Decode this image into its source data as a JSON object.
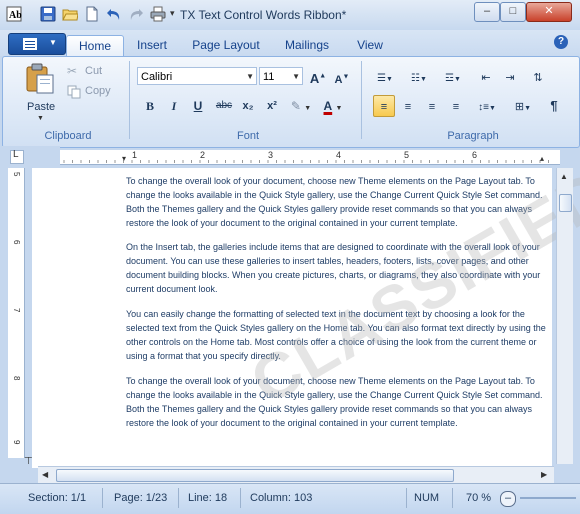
{
  "window": {
    "title": "TX Text Control Words Ribbon*",
    "minimize": "–",
    "maximize": "□",
    "close": "✕"
  },
  "tabs": {
    "home": "Home",
    "insert": "Insert",
    "page_layout": "Page Layout",
    "mailings": "Mailings",
    "view": "View",
    "help": "?"
  },
  "clipboard": {
    "paste": "Paste",
    "cut": "Cut",
    "copy": "Copy",
    "label": "Clipboard"
  },
  "font": {
    "family": "Calibri",
    "size": "11",
    "bold": "B",
    "italic": "I",
    "underline": "U",
    "strike": "abc",
    "subscript": "x₂",
    "superscript": "x²",
    "color_letter": "A",
    "label": "Font",
    "font_color": "#c00000"
  },
  "paragraph": {
    "label": "Paragraph"
  },
  "document": {
    "watermark": "CLASSIFIED",
    "paragraphs": [
      "To change the overall look of your document, choose new Theme elements on the Page Layout tab. To change the looks available in the Quick Style gallery, use the Change Current Quick Style Set command. Both the Themes gallery and the Quick Styles gallery provide reset commands so that you can always restore the look of your document to the original contained in your current template.",
      "On the Insert tab, the galleries include items that are designed to coordinate with the overall look of your document. You can use these galleries to insert tables, headers, footers, lists, cover pages, and other document building blocks. When you create pictures, charts, or diagrams, they also coordinate with your current document look.",
      "You can easily change the formatting of selected text in the document text by choosing a look for the selected text from the Quick Styles gallery on the Home tab. You can also format text directly by using the other controls on the Home tab. Most controls offer a choice of using the look from the current theme or using a format that you specify directly.",
      "To change the overall look of your document, choose new Theme elements on the Page Layout tab. To change the looks available in the Quick Style gallery, use the Change Current Quick Style Set command. Both the Themes gallery and the Quick Styles gallery provide reset commands so that you can always restore the look of your document to the original contained in your current template."
    ],
    "ruler_numbers": [
      "1",
      "2",
      "3",
      "4",
      "5",
      "6"
    ],
    "vruler_numbers": [
      "5",
      "6",
      "7",
      "8",
      "9"
    ]
  },
  "status": {
    "section": "Section: 1/1",
    "page": "Page: 1/23",
    "line": "Line: 18",
    "column": "Column: 103",
    "num": "NUM",
    "zoom": "70 %"
  }
}
